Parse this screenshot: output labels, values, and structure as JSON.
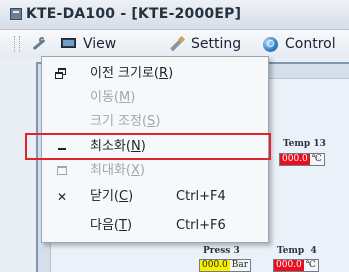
{
  "window": {
    "title": "KTE-DA100 - [KTE-2000EP]"
  },
  "menubar": {
    "items": [
      {
        "label": "View",
        "icon": "monitor-icon"
      },
      {
        "label": "Setting",
        "icon": "pencil-icon"
      },
      {
        "label": "Control",
        "icon": "globe-icon"
      }
    ],
    "lead_icon": "wrench-icon"
  },
  "context_menu": {
    "items": [
      {
        "glyph": "restore-icon",
        "label_pre": "이전 크기로(",
        "accel": "R",
        "label_post": ")",
        "shortcut": "",
        "enabled": true
      },
      {
        "glyph": "",
        "label_pre": "이동(",
        "accel": "M",
        "label_post": ")",
        "shortcut": "",
        "enabled": false
      },
      {
        "glyph": "",
        "label_pre": "크기 조정(",
        "accel": "S",
        "label_post": ")",
        "shortcut": "",
        "enabled": false
      },
      {
        "glyph": "minimize-icon",
        "label_pre": "최소화(",
        "accel": "N",
        "label_post": ")",
        "shortcut": "",
        "enabled": true,
        "highlighted": true
      },
      {
        "glyph": "maximize-icon",
        "label_pre": "최대화(",
        "accel": "X",
        "label_post": ")",
        "shortcut": "",
        "enabled": false
      },
      {
        "glyph": "✕",
        "label_pre": "닫기(",
        "accel": "C",
        "label_post": ")",
        "shortcut": "Ctrl+F4",
        "enabled": true
      },
      {
        "glyph": "",
        "label_pre": "다음(",
        "accel": "T",
        "label_post": ")",
        "shortcut": "Ctrl+F6",
        "enabled": true
      }
    ],
    "highlight_color": "#e0232d"
  },
  "gauges": {
    "temp13": {
      "label": "Temp 13",
      "value": "000.0",
      "unit": "℃",
      "color": "#e8101e"
    },
    "press3": {
      "label": "Press 3",
      "value": "000.0",
      "unit": "Bar",
      "color": "#f7f000"
    },
    "temp4": {
      "label": "Temp  4",
      "value": "000.0",
      "unit": "℃",
      "color": "#e8101e"
    }
  }
}
